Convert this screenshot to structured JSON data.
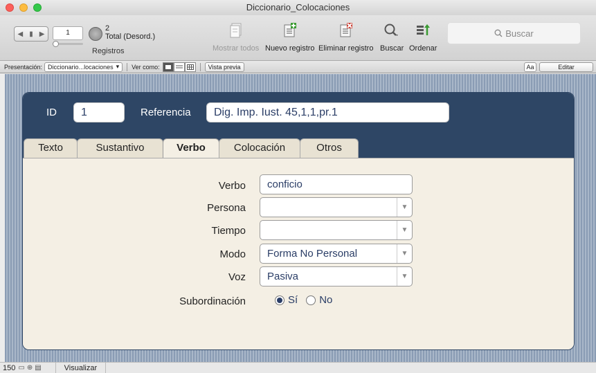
{
  "window": {
    "title": "Diccionario_Colocaciones"
  },
  "toolbar": {
    "record_number": "1",
    "total_count": "2",
    "total_label": "Total (Desord.)",
    "records_label": "Registros",
    "show_all_label": "Mostrar todos",
    "new_record_label": "Nuevo registro",
    "delete_record_label": "Eliminar registro",
    "find_label": "Buscar",
    "sort_label": "Ordenar",
    "search_placeholder": "Buscar"
  },
  "layoutbar": {
    "layout_label": "Presentación:",
    "layout_value": "Diccionario...locaciones",
    "view_as_label": "Ver como:",
    "preview_label": "Vista previa",
    "aa_label": "Aa",
    "edit_label": "Editar"
  },
  "header": {
    "id_label": "ID",
    "id_value": "1",
    "ref_label": "Referencia",
    "ref_value": "Dig. Imp. Iust. 45,1,1,pr.1"
  },
  "tabs": [
    {
      "label": "Texto"
    },
    {
      "label": "Sustantivo"
    },
    {
      "label": "Verbo"
    },
    {
      "label": "Colocación"
    },
    {
      "label": "Otros"
    }
  ],
  "form": {
    "verbo_label": "Verbo",
    "verbo_value": "conficio",
    "persona_label": "Persona",
    "persona_value": "",
    "tiempo_label": "Tiempo",
    "tiempo_value": "",
    "modo_label": "Modo",
    "modo_value": "Forma No Personal",
    "voz_label": "Voz",
    "voz_value": "Pasiva",
    "subord_label": "Subordinación",
    "subord_options": [
      "Sí",
      "No"
    ],
    "subord_selected": "Sí"
  },
  "statusbar": {
    "zoom": "150",
    "mode": "Visualizar"
  }
}
